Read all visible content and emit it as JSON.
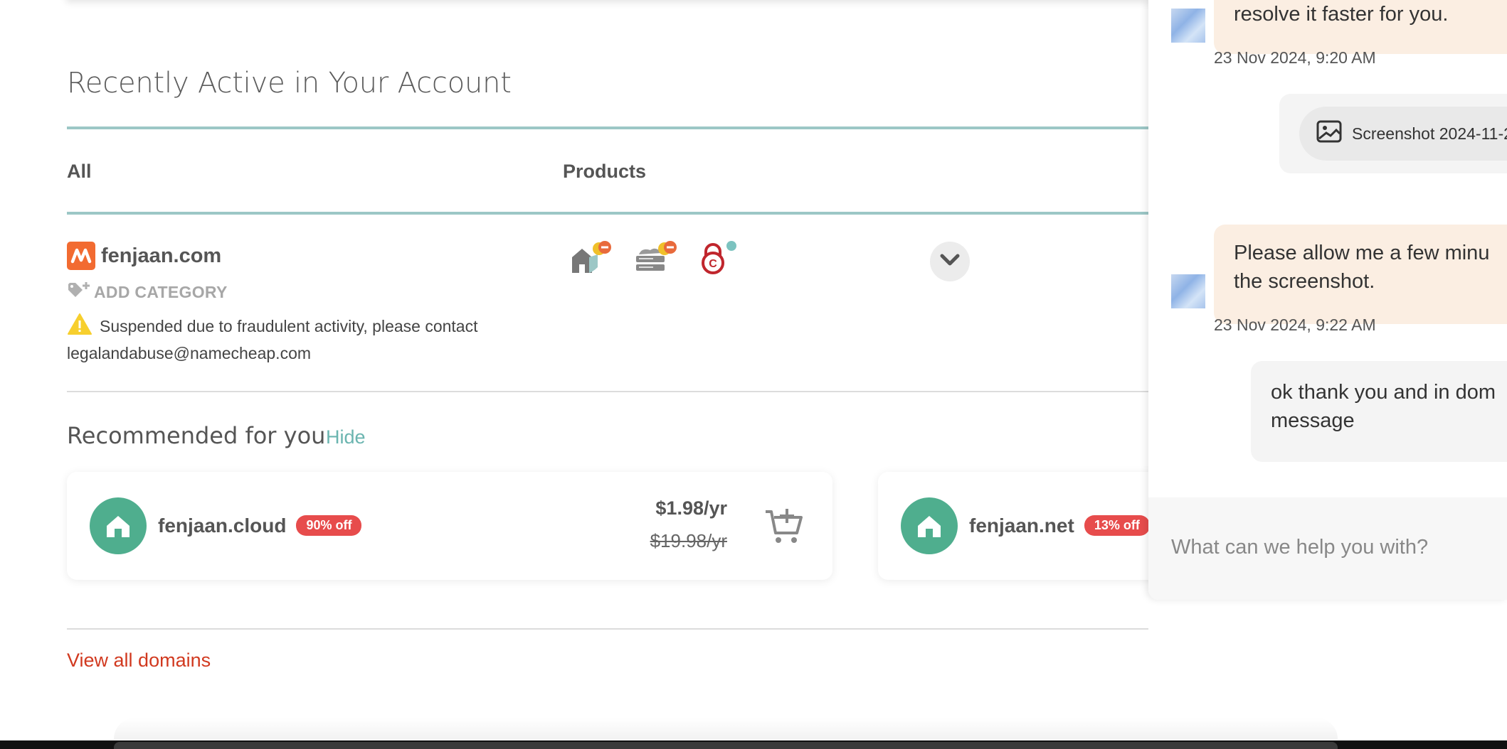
{
  "section": {
    "title": "Recently Active in Your Account"
  },
  "tabs": {
    "all": "All",
    "products": "Products"
  },
  "domain_row": {
    "name": "fenjaan.com",
    "add_category": "ADD CATEGORY",
    "warning_line1": "Suspended due to fraudulent activity, please contact",
    "warning_line2": "legalandabuse@namecheap.com",
    "product_icons": [
      "hosting-suspended-icon",
      "server-suspended-icon",
      "ssl-lock-icon"
    ]
  },
  "recommended": {
    "title": "Recommended for you",
    "hide_label": "Hide",
    "cards": [
      {
        "domain": "fenjaan.cloud",
        "badge": "90% off",
        "price": "$1.98/yr",
        "old_price": "$19.98/yr"
      },
      {
        "domain": "fenjaan.net",
        "badge": "13% off"
      }
    ]
  },
  "view_all": "View all domains",
  "chat": {
    "messages": [
      {
        "text": "resolve it faster for you.",
        "timestamp": "23 Nov 2024, 9:20 AM"
      },
      {
        "attachment": "Screenshot 2024-11-2"
      },
      {
        "text_line1": "Please allow me a few minu",
        "text_line2": "the screenshot.",
        "timestamp": "23 Nov 2024, 9:22 AM"
      },
      {
        "text_line1": "ok thank you and in dom",
        "text_line2": "message"
      }
    ],
    "input_placeholder": "What can we help you with?"
  },
  "colors": {
    "brand_orange": "#f26b31",
    "teal": "#9cc7c6",
    "link_teal": "#6bb5b0",
    "badge_red": "#e74c4c",
    "view_all_red": "#d1391f",
    "house_green": "#4fae8e"
  }
}
